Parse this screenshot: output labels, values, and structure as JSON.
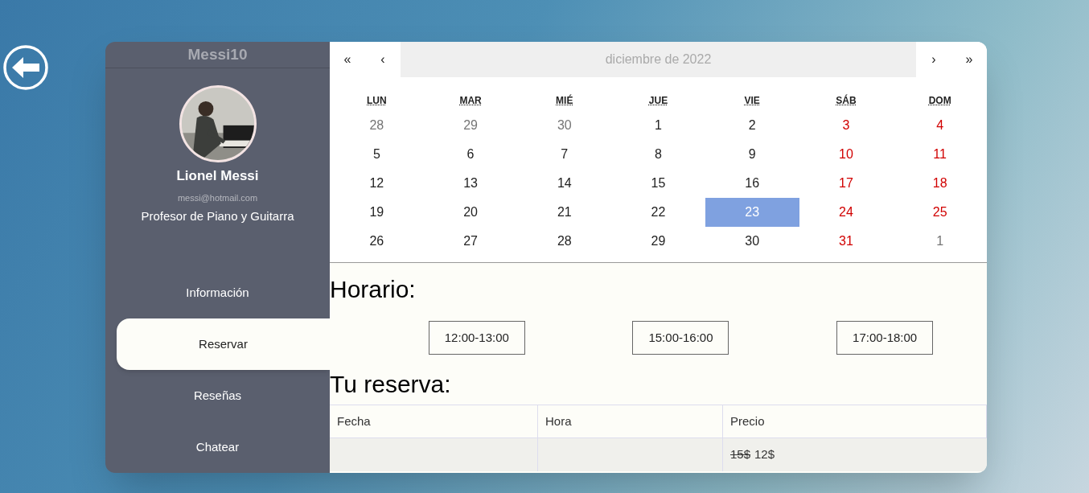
{
  "profile": {
    "username": "Messi10",
    "name": "Lionel Messi",
    "email": "messi@hotmail.com",
    "profession": "Profesor de Piano y Guitarra"
  },
  "menu": [
    {
      "label": "Información",
      "selected": false
    },
    {
      "label": "Reservar",
      "selected": true
    },
    {
      "label": "Reseñas",
      "selected": false
    },
    {
      "label": "Chatear",
      "selected": false
    }
  ],
  "calendar": {
    "nav": {
      "prev_year": "«",
      "prev_month": "‹",
      "title": "diciembre de 2022",
      "next_month": "›",
      "next_year": "»"
    },
    "weekdays": [
      "LUN",
      "MAR",
      "MIÉ",
      "JUE",
      "VIE",
      "SÁB",
      "DOM"
    ],
    "weeks": [
      [
        {
          "day": "28",
          "kind": "outside",
          "selected": false
        },
        {
          "day": "29",
          "kind": "outside",
          "selected": false
        },
        {
          "day": "30",
          "kind": "outside",
          "selected": false
        },
        {
          "day": "1",
          "kind": "weekday",
          "selected": false
        },
        {
          "day": "2",
          "kind": "weekday",
          "selected": false
        },
        {
          "day": "3",
          "kind": "weekend",
          "selected": false
        },
        {
          "day": "4",
          "kind": "weekend",
          "selected": false
        }
      ],
      [
        {
          "day": "5",
          "kind": "weekday",
          "selected": false
        },
        {
          "day": "6",
          "kind": "weekday",
          "selected": false
        },
        {
          "day": "7",
          "kind": "weekday",
          "selected": false
        },
        {
          "day": "8",
          "kind": "weekday",
          "selected": false
        },
        {
          "day": "9",
          "kind": "weekday",
          "selected": false
        },
        {
          "day": "10",
          "kind": "weekend",
          "selected": false
        },
        {
          "day": "11",
          "kind": "weekend",
          "selected": false
        }
      ],
      [
        {
          "day": "12",
          "kind": "weekday",
          "selected": false
        },
        {
          "day": "13",
          "kind": "weekday",
          "selected": false
        },
        {
          "day": "14",
          "kind": "weekday",
          "selected": false
        },
        {
          "day": "15",
          "kind": "weekday",
          "selected": false
        },
        {
          "day": "16",
          "kind": "weekday",
          "selected": false
        },
        {
          "day": "17",
          "kind": "weekend",
          "selected": false
        },
        {
          "day": "18",
          "kind": "weekend",
          "selected": false
        }
      ],
      [
        {
          "day": "19",
          "kind": "weekday",
          "selected": false
        },
        {
          "day": "20",
          "kind": "weekday",
          "selected": false
        },
        {
          "day": "21",
          "kind": "weekday",
          "selected": false
        },
        {
          "day": "22",
          "kind": "weekday",
          "selected": false
        },
        {
          "day": "23",
          "kind": "weekday",
          "selected": true
        },
        {
          "day": "24",
          "kind": "weekend",
          "selected": false
        },
        {
          "day": "25",
          "kind": "weekend",
          "selected": false
        }
      ],
      [
        {
          "day": "26",
          "kind": "weekday",
          "selected": false
        },
        {
          "day": "27",
          "kind": "weekday",
          "selected": false
        },
        {
          "day": "28",
          "kind": "weekday",
          "selected": false
        },
        {
          "day": "29",
          "kind": "weekday",
          "selected": false
        },
        {
          "day": "30",
          "kind": "weekday",
          "selected": false
        },
        {
          "day": "31",
          "kind": "weekend",
          "selected": false
        },
        {
          "day": "1",
          "kind": "outside",
          "selected": false
        }
      ]
    ]
  },
  "schedule": {
    "title": "Horario:",
    "slots": [
      "12:00-13:00",
      "15:00-16:00",
      "17:00-18:00"
    ]
  },
  "booking": {
    "title": "Tu reserva:",
    "columns": [
      "Fecha",
      "Hora",
      "Precio"
    ],
    "row": {
      "old_price": "15$",
      "new_price": "12$"
    }
  }
}
